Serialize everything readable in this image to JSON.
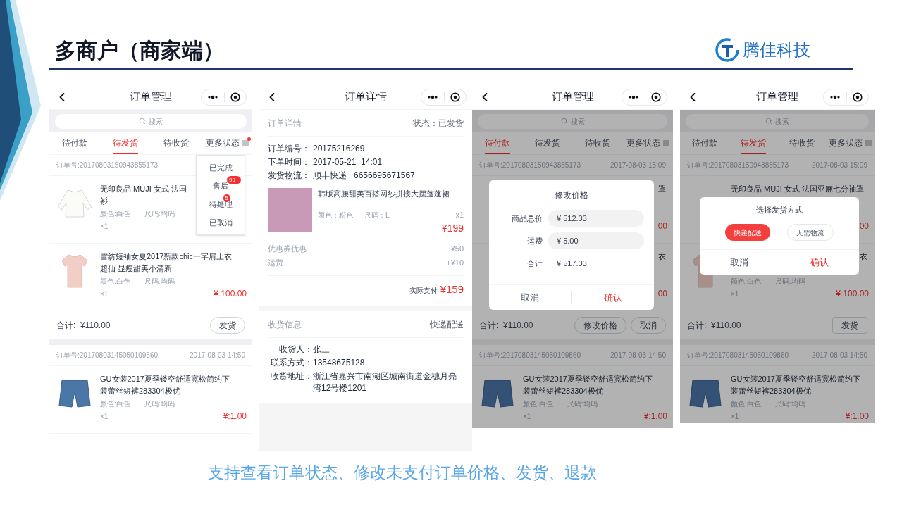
{
  "slide": {
    "title": "多商户（商家端）",
    "logo_text": "腾佳科技",
    "caption": "支持查看订单状态、修改未支付订单价格、发货、退款"
  },
  "phones": [
    {
      "kind": "order_list",
      "nav_title": "订单管理",
      "search_placeholder": "搜索",
      "dimmed": false,
      "tabs": [
        {
          "label": "待付款",
          "selected": false,
          "dot": false
        },
        {
          "label": "待发货",
          "selected": true,
          "dot": false
        },
        {
          "label": "待收货",
          "selected": false,
          "dot": false
        },
        {
          "label": "更多状态",
          "selected": false,
          "dot": true
        }
      ],
      "menu": [
        {
          "label": "已完成"
        },
        {
          "label": "售后",
          "badge": "99+"
        },
        {
          "label": "待处理",
          "badge": "5"
        },
        {
          "label": "已取消"
        }
      ],
      "orders": [
        {
          "number": "订单号:20170803150943855173",
          "items": [
            {
              "kind": "blouse",
              "title_lines": [
                "无印良品 MUJI 女式 法国",
                "衫"
              ],
              "color_spec": "颜色:白色",
              "size_spec": "尺码:均码",
              "qty": "×1"
            },
            {
              "kind": "tee",
              "title_lines": [
                "雪纺短袖女夏2017新款chic一字肩上衣",
                "超仙 显瘦甜美小清新"
              ],
              "color_spec": "颜色:白色",
              "size_spec": "尺码:均码",
              "qty": "×1",
              "price": "¥:100.00"
            }
          ],
          "total_label": "合计:",
          "total": "¥110.00",
          "actions": [
            {
              "label": "发货",
              "kind": "pill"
            }
          ]
        },
        {
          "number": "订单号:20170803145050109860",
          "date": "2017-08-03 14:50",
          "items": [
            {
              "kind": "shorts",
              "title_lines": [
                "GU女装2017夏季镂空舒适宽松简约下",
                "装蕾丝短裤283304极优"
              ],
              "color_spec": "颜色:白色",
              "size_spec": "尺码:均码",
              "qty": "×1",
              "price": "¥:1.00"
            }
          ]
        }
      ]
    },
    {
      "kind": "order_detail",
      "nav_title": "订单详情",
      "section_title": "订单详情",
      "status": "状态：已发货",
      "fields": [
        {
          "label": "订单编号：",
          "value": "20175216269"
        },
        {
          "label": "下单时间：",
          "value": "2017-05-21  14:01"
        },
        {
          "label": "发货物流：",
          "value": "顺丰快递   6656695671567"
        }
      ],
      "product": {
        "title": "韩版高腰甜美百搭网纱拼接大摆蓬蓬裙",
        "color_spec": "颜色：粉色",
        "size_spec": "尺码：L",
        "qty": "x1",
        "price": "¥199"
      },
      "fees": [
        {
          "label": "优惠券优惠",
          "value": "−¥50"
        },
        {
          "label": "运费",
          "value": "+¥10"
        }
      ],
      "paid_label": "实际支付",
      "paid": "¥159",
      "shipping_title": "收货信息",
      "shipping_method": "快递配送",
      "shipping_fields": [
        {
          "label": "收货人：",
          "value": "张三"
        },
        {
          "label": "联系方式：",
          "value": "13548675128"
        },
        {
          "label": "收货地址：",
          "value": "浙江省嘉兴市南湖区城南街道金穗月亮湾12号楼1201"
        }
      ]
    },
    {
      "kind": "order_list",
      "nav_title": "订单管理",
      "search_placeholder": "搜索",
      "dimmed": true,
      "tabs": [
        {
          "label": "待付款",
          "selected": true,
          "dot": false
        },
        {
          "label": "待发货",
          "selected": false,
          "dot": false
        },
        {
          "label": "待收货",
          "selected": false,
          "dot": false
        },
        {
          "label": "更多状态",
          "selected": false,
          "dot": false
        }
      ],
      "orders": [
        {
          "number": "订单号:20170803150943855173",
          "date": "2017-08-03 15:09",
          "items": [
            {
              "kind": "partial",
              "title_tail": "罩",
              "price": "00"
            },
            {
              "kind": "partial",
              "title_tail": "衣",
              "price": "00"
            }
          ],
          "total_label": "合计:",
          "total": "¥110.00",
          "actions": [
            {
              "label": "修改价格",
              "kind": "pill"
            },
            {
              "label": "取消",
              "kind": "pill"
            }
          ]
        },
        {
          "number": "订单号:20170803145050109860",
          "date": "2017-08-03 14:50",
          "items": [
            {
              "kind": "shorts",
              "title_lines": [
                "GU女装2017夏季镂空舒适宽松简约下",
                "装蕾丝短裤283304极优"
              ],
              "color_spec": "颜色:白色",
              "size_spec": "尺码:均码",
              "qty": "×1",
              "price": "¥:1.00"
            }
          ]
        }
      ],
      "dialog": {
        "kind": "price",
        "title": "修改价格",
        "fields": [
          {
            "label": "商品总价",
            "value": "¥ 512.03",
            "editable": true
          },
          {
            "label": "运费",
            "value": "¥ 5.00",
            "editable": true
          },
          {
            "label": "合计",
            "value": "¥ 517.03",
            "editable": false
          }
        ],
        "cancel": "取消",
        "confirm": "确认"
      }
    },
    {
      "kind": "order_list",
      "nav_title": "订单管理",
      "search_placeholder": "搜索",
      "dimmed": true,
      "tabs": [
        {
          "label": "待付款",
          "selected": false,
          "dot": false
        },
        {
          "label": "待发货",
          "selected": true,
          "dot": false
        },
        {
          "label": "待收货",
          "selected": false,
          "dot": false
        },
        {
          "label": "更多状态",
          "selected": false,
          "dot": false
        }
      ],
      "orders": [
        {
          "number": "订单号:20170803150943855173",
          "date": "2017-08-03 15:09",
          "items": [
            {
              "kind": "partial",
              "title_lines": [
                "无印良品 MUJI 女式 法国亚麻七分袖罩"
              ],
              "price": "00"
            },
            {
              "kind": "tee",
              "title_tail": "衣",
              "color_spec": "颜色:白色",
              "size_spec": "尺码:均码",
              "qty": "×1",
              "price": "¥:100.00"
            }
          ],
          "total_label": "合计:",
          "total": "¥110.00",
          "actions": [
            {
              "label": "发货",
              "kind": "square"
            }
          ]
        },
        {
          "number": "订单号:20170803145050109860",
          "date": "2017-08-03 14:50",
          "items": [
            {
              "kind": "shorts",
              "title_lines": [
                "GU女装2017夏季镂空舒适宽松简约下",
                "装蕾丝短裤283304极优"
              ],
              "color_spec": "颜色:白色",
              "size_spec": "尺码:均码",
              "qty": "×1",
              "price": "¥:1.00"
            }
          ]
        }
      ],
      "dialog": {
        "kind": "shipping",
        "title": "选择发货方式",
        "options": [
          {
            "label": "快递配送",
            "selected": true
          },
          {
            "label": "无需物流",
            "selected": false
          }
        ],
        "cancel": "取消",
        "confirm": "确认"
      }
    }
  ]
}
